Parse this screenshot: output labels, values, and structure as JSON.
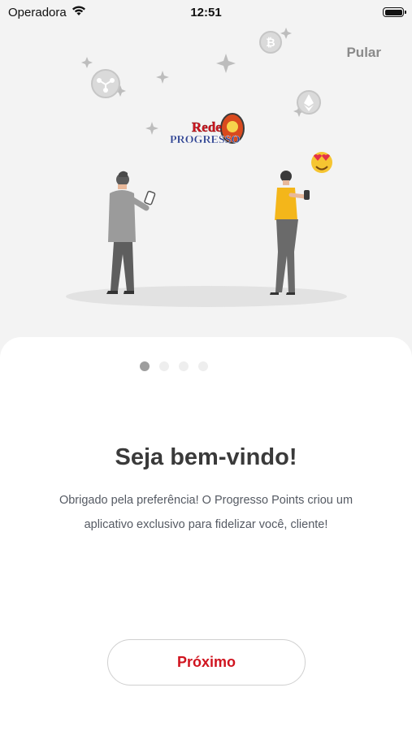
{
  "status_bar": {
    "carrier": "Operadora",
    "time": "12:51"
  },
  "header": {
    "skip_label": "Pular"
  },
  "illustration": {
    "logo_line1": "Rede",
    "logo_line2": "PROGRESSO"
  },
  "pagination": {
    "total": 4,
    "active_index": 0
  },
  "content": {
    "title": "Seja bem-vindo!",
    "description_line1": "Obrigado pela preferência! O Progresso Points criou um",
    "description_line2": "aplicativo exclusivo para fidelizar você, cliente!"
  },
  "actions": {
    "next_label": "Próximo"
  },
  "colors": {
    "accent": "#d0141f",
    "background": "#f3f3f3",
    "card": "#ffffff"
  }
}
